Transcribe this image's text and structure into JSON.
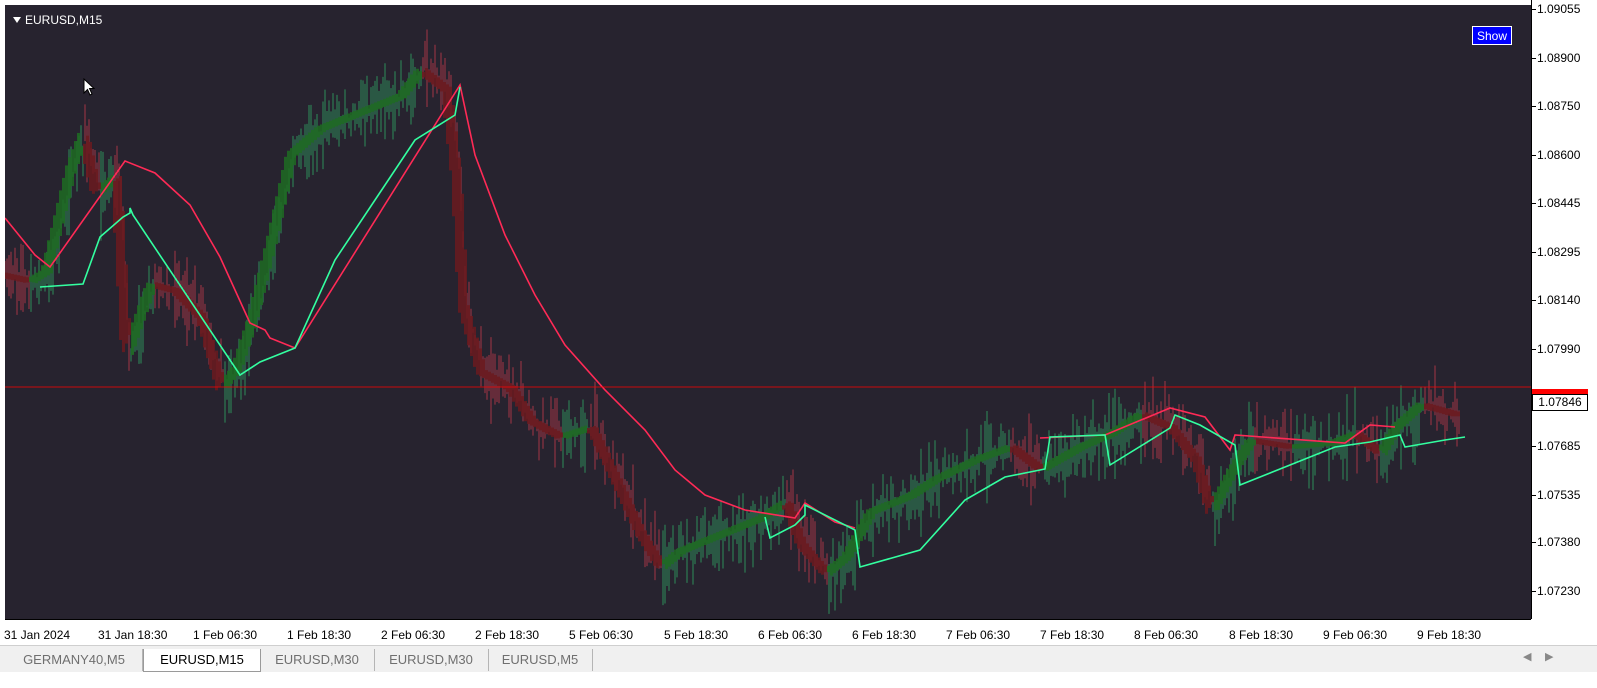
{
  "chart": {
    "symbol": "EURUSD,M15",
    "show_button": "Show",
    "current_price": "1.07846",
    "colors": {
      "background": "#27232f",
      "up_line": "#33ffa0",
      "down_line": "#ff2a56",
      "bull_band": "#1f6b22",
      "bear_band": "#6b1a1f",
      "price_line": "#ff0000"
    },
    "price_axis": [
      "1.09055",
      "1.08900",
      "1.08750",
      "1.08600",
      "1.08445",
      "1.08295",
      "1.08140",
      "1.07990",
      "1.07846",
      "1.07685",
      "1.07535",
      "1.07380",
      "1.07230"
    ],
    "time_axis": [
      "31 Jan 2024",
      "31 Jan 18:30",
      "1 Feb 06:30",
      "1 Feb 18:30",
      "2 Feb 06:30",
      "2 Feb 18:30",
      "5 Feb 06:30",
      "5 Feb 18:30",
      "6 Feb 06:30",
      "6 Feb 18:30",
      "7 Feb 06:30",
      "7 Feb 18:30",
      "8 Feb 06:30",
      "8 Feb 18:30",
      "9 Feb 06:30",
      "9 Feb 18:30"
    ]
  },
  "chart_data": {
    "type": "line",
    "title": "EURUSD,M15",
    "ylim": [
      1.0719,
      1.0908
    ],
    "x": [
      "31 Jan 2024",
      "31 Jan 18:30",
      "1 Feb 06:30",
      "1 Feb 18:30",
      "2 Feb 06:30",
      "2 Feb 18:30",
      "5 Feb 06:30",
      "5 Feb 18:30",
      "6 Feb 06:30",
      "6 Feb 18:30",
      "7 Feb 06:30",
      "7 Feb 18:30",
      "8 Feb 06:30",
      "8 Feb 18:30",
      "9 Feb 06:30",
      "9 Feb 18:30"
    ],
    "series": [
      {
        "values": [
          1.0822,
          1.086,
          1.0815,
          1.087,
          1.0888,
          1.0795,
          1.0782,
          1.074,
          1.0748,
          1.075,
          1.0765,
          1.0772,
          1.078,
          1.0775,
          1.0772,
          1.0783
        ]
      }
    ]
  },
  "tabs": [
    {
      "label": "GERMANY40,M5",
      "active": false
    },
    {
      "label": "EURUSD,M15",
      "active": true
    },
    {
      "label": "EURUSD,M30",
      "active": false
    },
    {
      "label": "EURUSD,M30",
      "active": false
    },
    {
      "label": "EURUSD,M5",
      "active": false
    }
  ]
}
